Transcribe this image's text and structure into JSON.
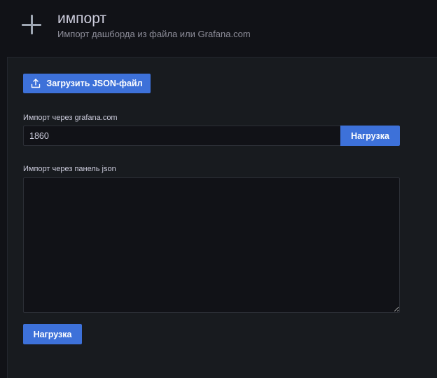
{
  "header": {
    "icon": "plus-icon",
    "title": "импорт",
    "subtitle": "Импорт дашборда из файла или Grafana.com"
  },
  "upload": {
    "label": "Загрузить JSON-файл",
    "icon": "upload-icon"
  },
  "grafana_import": {
    "label": "Импорт через grafana.com",
    "value": "1860",
    "button_label": "Нагрузка"
  },
  "json_import": {
    "label": "Импорт через панель json",
    "value": "",
    "button_label": "Нагрузка"
  },
  "colors": {
    "primary_button": "#3d71d9",
    "background": "#111217",
    "panel": "#181b1f"
  }
}
